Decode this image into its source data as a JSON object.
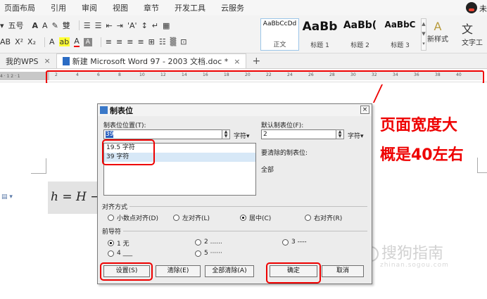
{
  "menu": {
    "items": [
      "页面布局",
      "引用",
      "审阅",
      "视图",
      "章节",
      "开发工具",
      "云服务"
    ],
    "right_text": "未"
  },
  "ribbon": {
    "font_size": "五号",
    "font_size_arrow": "▾",
    "grow_font": "A",
    "shrink_font": "A",
    "clear_format": "✎",
    "phonetic": "雙",
    "list_items": [
      "☰",
      "☰",
      "⇤",
      "⇥",
      "'A'",
      "↕",
      "↵",
      "▦"
    ],
    "format_row2_left": "AB",
    "superscript": "X²",
    "subscript": "X₂",
    "text_effect": "A",
    "highlight": "ab",
    "font_color": "A",
    "char_border": "A",
    "align_items": [
      "≡",
      "≡",
      "≡",
      "≡",
      "⊞",
      "☷",
      "▒",
      "⊡"
    ],
    "styles": [
      {
        "sample": "AaBbCcDd",
        "name": "正文"
      },
      {
        "sample": "AaBb",
        "name": "标题 1"
      },
      {
        "sample": "AaBb(",
        "name": "标题 2"
      },
      {
        "sample": "AaBbC",
        "name": "标题 3"
      }
    ],
    "new_style_label": "新样式",
    "new_style_glyph": "A",
    "text_tool_label": "文字工",
    "text_tool_glyph": "文"
  },
  "tabs": {
    "items": [
      {
        "label": "我的WPS",
        "active": false
      },
      {
        "label": "新建 Microsoft Word 97 - 2003 文档.doc *",
        "active": true
      }
    ],
    "close_glyph": "×",
    "add_glyph": "+"
  },
  "ruler": {
    "left_text": "4 · 1 2 · 1",
    "ticks": [
      "2",
      "4",
      "6",
      "8",
      "10",
      "12",
      "14",
      "16",
      "18",
      "20",
      "22",
      "24",
      "26",
      "28",
      "30",
      "32",
      "34",
      "36",
      "38",
      "40"
    ]
  },
  "document": {
    "formula": "h = H − ",
    "annotation_line1": "页面宽度大",
    "annotation_line2": "概是40左右",
    "watermark": "搜狗指南",
    "watermark_url": "zhinan.sogou.com"
  },
  "dialog": {
    "title": "制表位",
    "close_glyph": "×",
    "position_label": "制表位位置(T):",
    "position_value": "39",
    "unit_label": "字符▾",
    "default_label": "默认制表位(F):",
    "default_value": "2",
    "default_unit": "字符▾",
    "clear_label": "要清除的制表位:",
    "clear_value": "全部",
    "tab_list": [
      "19.5 字符",
      "39 字符"
    ],
    "align_group": "对齐方式",
    "align_options": [
      {
        "label": "小数点对齐(D)",
        "checked": false
      },
      {
        "label": "左对齐(L)",
        "checked": false
      },
      {
        "label": "居中(C)",
        "checked": true
      },
      {
        "label": "右对齐(R)",
        "checked": false
      }
    ],
    "leader_group": "前导符",
    "leader_options": [
      {
        "label": "1 无",
        "checked": true
      },
      {
        "label": "2 ......",
        "checked": false
      },
      {
        "label": "3 ----",
        "checked": false
      },
      {
        "label": "4 ___",
        "checked": false
      },
      {
        "label": "5 ······",
        "checked": false
      }
    ],
    "buttons": {
      "set": "设置(S)",
      "clear": "清除(E)",
      "clear_all": "全部清除(A)",
      "ok": "确定",
      "cancel": "取消"
    }
  },
  "colors": {
    "highlight_red": "#e00000",
    "accent_blue": "#2a5fbd"
  }
}
